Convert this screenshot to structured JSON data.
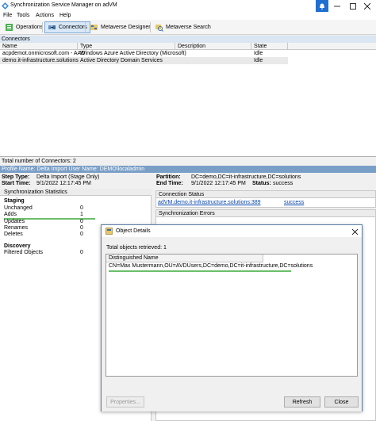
{
  "window": {
    "title": "Synchronization Service Manager on adVM"
  },
  "menu": [
    "File",
    "Tools",
    "Actions",
    "Help"
  ],
  "toolbar": {
    "buttons": [
      {
        "label": "Operations",
        "icon": "operations-icon"
      },
      {
        "label": "Connectors",
        "icon": "connectors-icon"
      },
      {
        "label": "Metaverse Designer",
        "icon": "metaverse-designer-icon"
      },
      {
        "label": "Metaverse Search",
        "icon": "metaverse-search-icon"
      }
    ]
  },
  "connectors": {
    "header": "Connectors",
    "columns": [
      "Name",
      "Type",
      "Description",
      "State"
    ],
    "rows": [
      {
        "name": "acpdemot.onmicrosoft.com - AAD",
        "type": "Windows Azure Active Directory (Microsoft)",
        "description": "",
        "state": "Idle"
      },
      {
        "name": "demo.it-infrastructure.solutions",
        "type": "Active Directory Domain Services",
        "description": "",
        "state": "Idle"
      }
    ],
    "total": "Total number of Connectors: 2"
  },
  "profile": {
    "bar": "Profile Name: Delta Import  User Name: DEMO\\localadmin",
    "step_type_label": "Step Type:",
    "step_type": "Delta Import (Stage Only)",
    "start_time_label": "Start Time:",
    "start_time": "9/1/2022 12:17:45 PM",
    "partition_label": "Partition:",
    "partition": "DC=demo,DC=it-infrastructure,DC=solutions",
    "end_time_label": "End Time:",
    "end_time": "9/1/2022 12:17:45 PM",
    "status_label": "Status:",
    "status": "success"
  },
  "stats": {
    "header": "Synchronization Statistics",
    "staging_label": "Staging",
    "staging": [
      {
        "label": "Unchanged",
        "value": "0"
      },
      {
        "label": "Adds",
        "value": "1"
      },
      {
        "label": "Updates",
        "value": "0"
      },
      {
        "label": "Renames",
        "value": "0"
      },
      {
        "label": "Deletes",
        "value": "0"
      }
    ],
    "discovery_label": "Discovery",
    "discovery": [
      {
        "label": "Filtered Objects",
        "value": "0"
      }
    ]
  },
  "connection_status": {
    "header": "Connection Status",
    "server": "adVM.demo.it-infrastructure.solutions:389",
    "result": "success"
  },
  "sync_errors": {
    "header": "Synchronization Errors"
  },
  "dialog": {
    "title": "Object Details",
    "total": "Total objects retrieved: 1",
    "column": "Distinguished Name",
    "row": "CN=Max Mustermann,OU=AVDUsers,DC=demo,DC=it-infrastructure,DC=solutions",
    "buttons": {
      "properties": "Properties...",
      "refresh": "Refresh",
      "close": "Close"
    }
  },
  "colors": {
    "highlight": "#6abf69",
    "accent": "#7a9fc7",
    "link": "#0645ad"
  }
}
